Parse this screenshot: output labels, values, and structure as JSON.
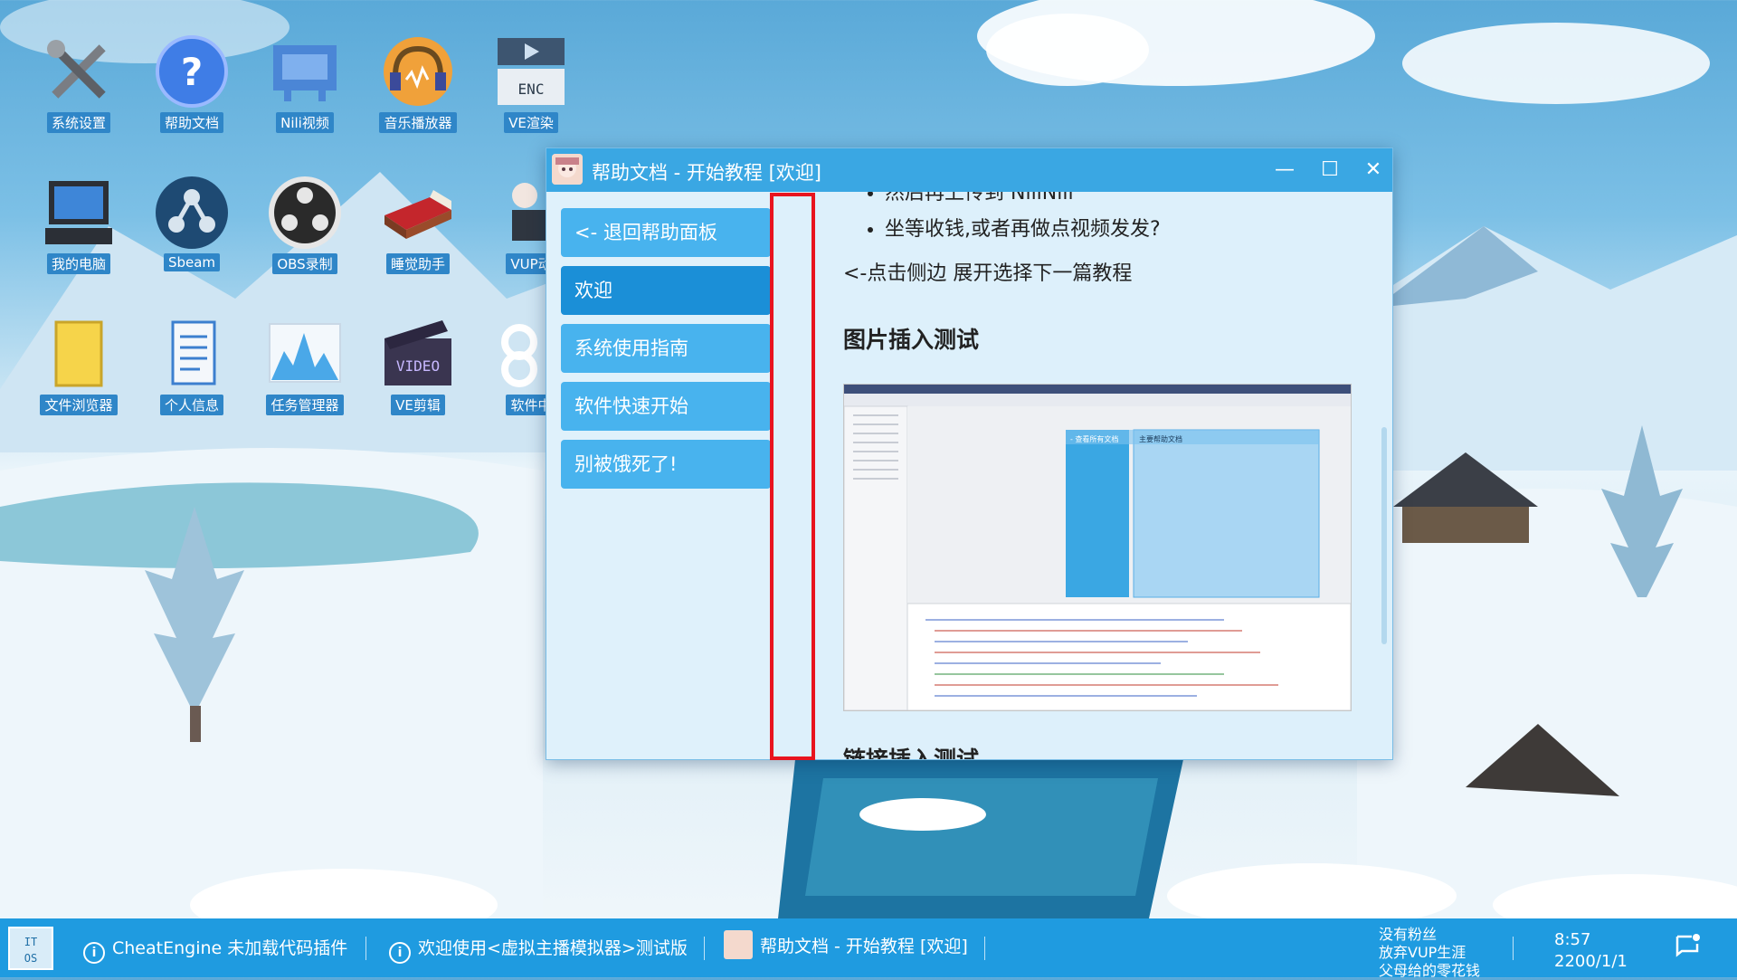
{
  "window": {
    "title": "帮助文档 - 开始教程 [欢迎]",
    "controls": {
      "minimize": "—",
      "maximize": "☐",
      "close": "✕"
    },
    "sidebar": {
      "items": [
        {
          "label": "<- 退回帮助面板",
          "active": false
        },
        {
          "label": "欢迎",
          "active": true
        },
        {
          "label": "系统使用指南",
          "active": false
        },
        {
          "label": "软件快速开始",
          "active": false
        },
        {
          "label": "别被饿死了!",
          "active": false
        }
      ]
    },
    "content": {
      "bullets": [
        "然后再上传到 NiliNili",
        "坐等收钱,或者再做点视频发发?"
      ],
      "hint": "<-点击侧边 展开选择下一篇教程",
      "heading_image": "图片插入测试",
      "heading_link": "链接插入测试",
      "screenshot": {
        "left_panel_label": "- 查看所有文档",
        "right_panel_label": "主要帮助文档"
      }
    }
  },
  "desktop": {
    "icons": [
      {
        "label": "系统设置",
        "icon": "tools-icon"
      },
      {
        "label": "帮助文档",
        "icon": "help-icon"
      },
      {
        "label": "Nili视频",
        "icon": "tv-icon"
      },
      {
        "label": "音乐播放器",
        "icon": "headphones-icon"
      },
      {
        "label": "VE渲染",
        "icon": "encoder-icon"
      },
      {
        "label": "我的电脑",
        "icon": "computer-icon"
      },
      {
        "label": "Sbeam",
        "icon": "steam-icon"
      },
      {
        "label": "OBS录制",
        "icon": "obs-icon"
      },
      {
        "label": "睡觉助手",
        "icon": "bed-icon"
      },
      {
        "label": "VUP动",
        "icon": "vup-icon"
      },
      {
        "label": "文件浏览器",
        "icon": "folder-icon"
      },
      {
        "label": "个人信息",
        "icon": "document-icon"
      },
      {
        "label": "任务管理器",
        "icon": "chart-icon"
      },
      {
        "label": "VE剪辑",
        "icon": "video-icon"
      },
      {
        "label": "软件中",
        "icon": "store-icon"
      }
    ]
  },
  "taskbar": {
    "items": [
      {
        "label": "CheatEngine 未加载代码插件",
        "icon": "info-icon"
      },
      {
        "label": "欢迎使用<虚拟主播模拟器>测试版",
        "icon": "info-icon"
      },
      {
        "label": "帮助文档 - 开始教程 [欢迎]",
        "icon": "app-icon"
      }
    ],
    "status_lines": [
      "没有粉丝",
      "放弃VUP生涯",
      "父母给的零花钱"
    ],
    "time": "8:57",
    "date": "2200/1/1"
  },
  "colors": {
    "accent": "#3aa7e3",
    "sidebar_button": "#48b3ee",
    "sidebar_button_active": "#1b8fd7",
    "taskbar": "#1f9be0",
    "highlight_box": "#e8141e"
  }
}
